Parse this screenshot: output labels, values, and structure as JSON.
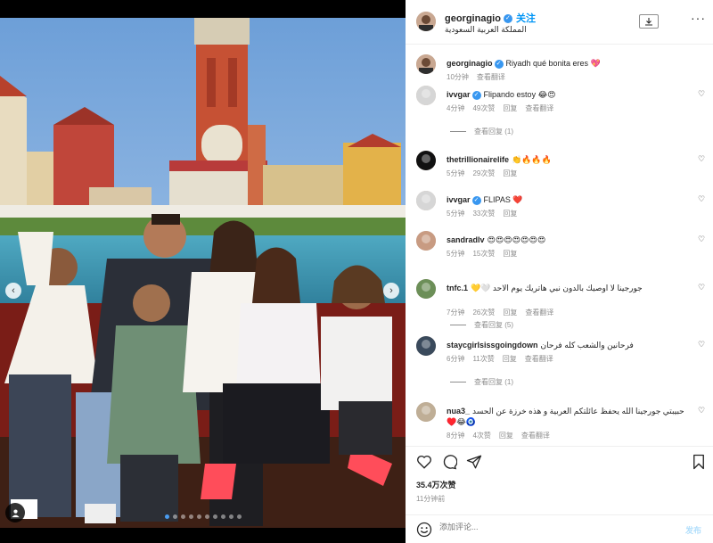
{
  "header": {
    "username": "georginagio",
    "follow_label": "关注",
    "location": "المملكة العربية السعودية"
  },
  "caption": {
    "username": "georginagio",
    "text": "Riyadh qué bonita eres 💖",
    "time": "10分钟",
    "translate": "查看翻译"
  },
  "comments": [
    {
      "user": "ivvgar",
      "verified": true,
      "text": "Flipando estoy 😂😍",
      "time": "4分钟",
      "likes": "49次赞",
      "reply": "回复",
      "translate": "查看翻译",
      "replies": "查看回复 (1)"
    },
    {
      "user": "thetrillionairelife",
      "verified": false,
      "text": "👏🔥🔥🔥",
      "time": "5分钟",
      "likes": "29次赞",
      "reply": "回复",
      "translate": "",
      "replies": ""
    },
    {
      "user": "ivvgar",
      "verified": true,
      "text": "FLIPAS ❤️",
      "time": "5分钟",
      "likes": "33次赞",
      "reply": "回复",
      "translate": "",
      "replies": ""
    },
    {
      "user": "sandradlv",
      "verified": false,
      "text": "😍😍😍😍😍😍😍",
      "time": "5分钟",
      "likes": "15次赞",
      "reply": "回复",
      "translate": "",
      "replies": ""
    },
    {
      "user": "tnfc.1",
      "verified": false,
      "text": "جورجينا لا اوصيك بالدون نبي هاتريك يوم الاحد 🤍💛",
      "time": "7分钟",
      "likes": "26次赞",
      "reply": "回复",
      "translate": "查看翻译",
      "replies": "查看回复 (5)"
    },
    {
      "user": "staycgirlsissgoingdown",
      "verified": false,
      "text": "فرحانين والشعب كله فرحان",
      "time": "6分钟",
      "likes": "11次赞",
      "reply": "回复",
      "translate": "查看翻译",
      "replies": "查看回复 (1)"
    },
    {
      "user": "nua3_",
      "verified": false,
      "text": "حبيبتي جورجينا الله يحفظ عائلتكم العربية و هذه خرزة عن الحسد 🧿😂♥️",
      "time": "8分钟",
      "likes": "4次赞",
      "reply": "回复",
      "translate": "查看翻译",
      "replies": ""
    }
  ],
  "likes_count": "35.4万次赞",
  "posted_time": "11分钟前",
  "add_comment": {
    "placeholder": "添加评论...",
    "post_label": "发布"
  },
  "carousel": {
    "total": 10,
    "active": 0
  },
  "colors": {
    "accent": "#0095f6",
    "verified": "#3897f0",
    "dot_active": "#4a9cf0"
  },
  "icons": [
    "download-icon",
    "more-options-icon",
    "heart-icon",
    "comment-icon",
    "share-icon",
    "bookmark-icon",
    "emoji-icon",
    "chevron-left-icon",
    "chevron-right-icon",
    "tag-user-icon"
  ]
}
